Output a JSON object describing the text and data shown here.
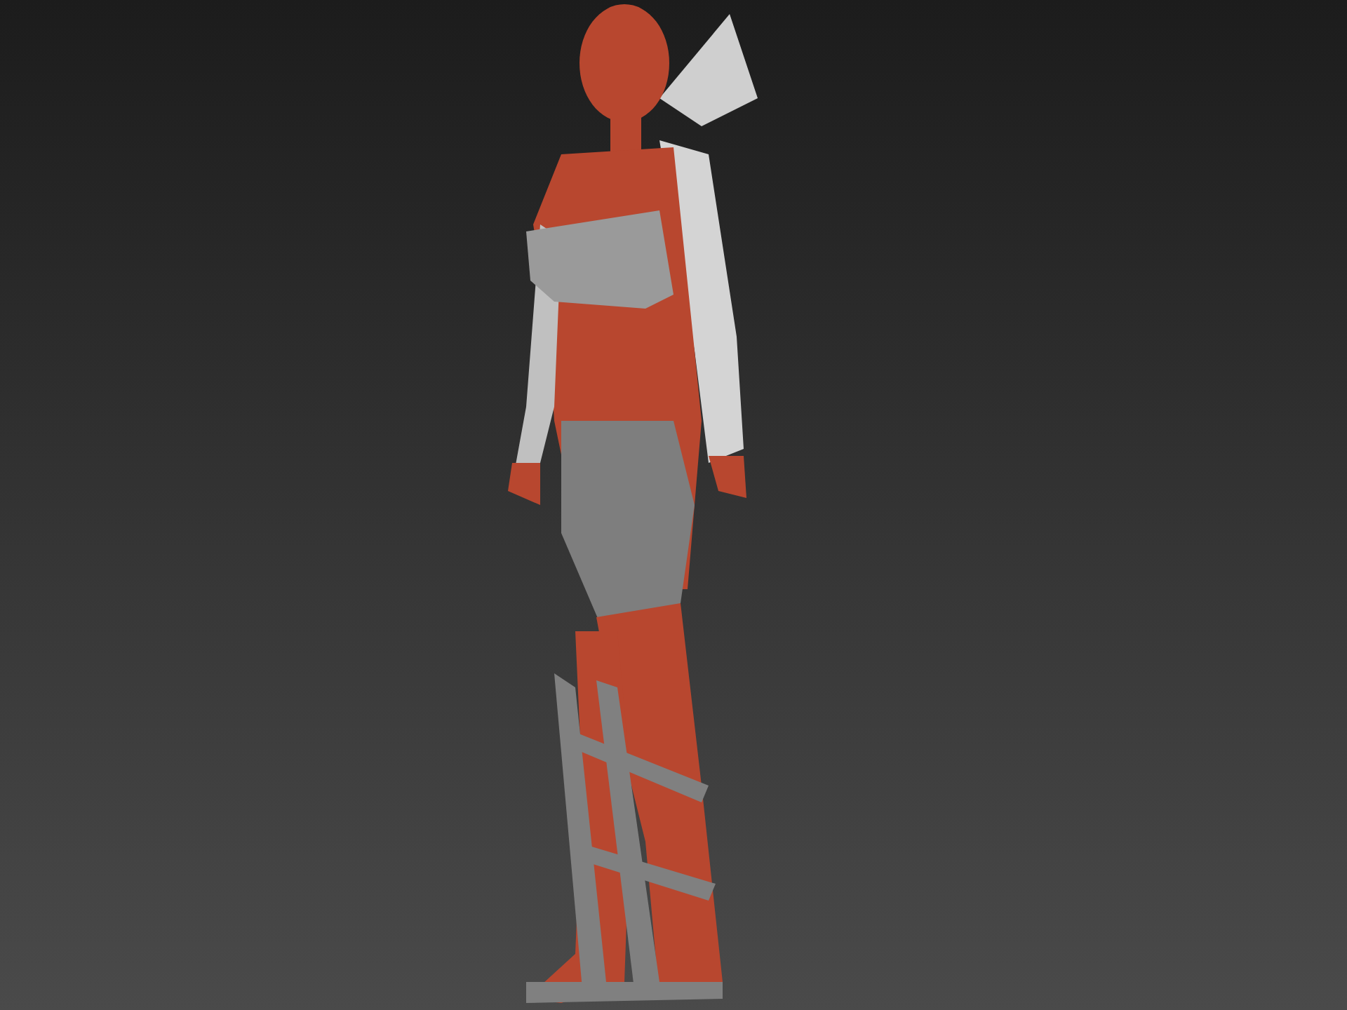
{
  "viewport": {
    "model": {
      "kind": "figure"
    }
  }
}
